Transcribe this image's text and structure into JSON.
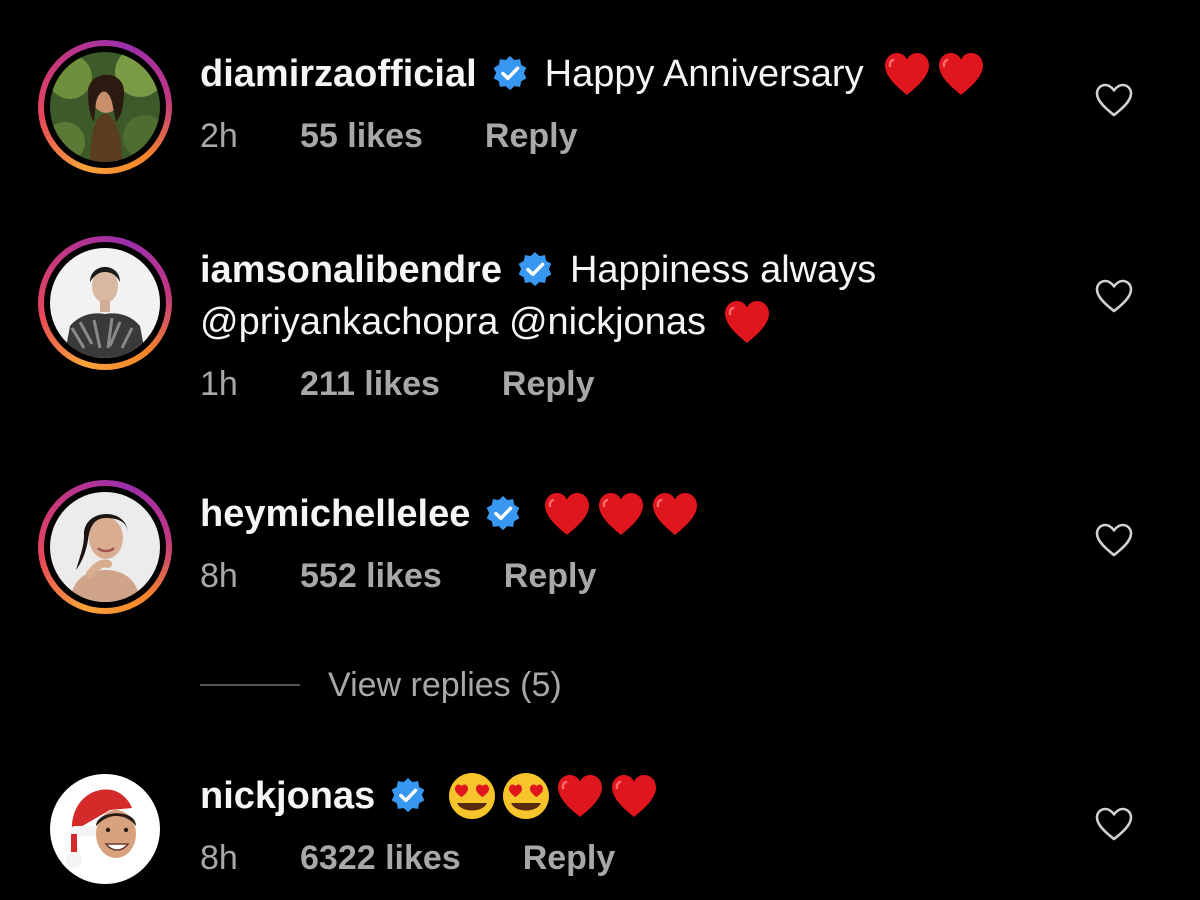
{
  "colors": {
    "background": "#000000",
    "text_primary": "#f5f5f5",
    "text_secondary": "#a8a8a8",
    "verified_blue": "#3897f0",
    "heart_red": "#e0161e"
  },
  "comments": [
    {
      "username": "diamirzaofficial",
      "verified": true,
      "text": "Happy Anniversary",
      "emojis": [
        "red-heart",
        "red-heart"
      ],
      "time": "2h",
      "likes": "55 likes",
      "reply_label": "Reply",
      "has_story_ring": true
    },
    {
      "username": "iamsonalibendre",
      "verified": true,
      "text": "Happiness always",
      "text_line2": "@priyankachopra @nickjonas",
      "emojis": [
        "red-heart"
      ],
      "time": "1h",
      "likes": "211 likes",
      "reply_label": "Reply",
      "has_story_ring": true
    },
    {
      "username": "heymichellelee",
      "verified": true,
      "text": "",
      "emojis": [
        "red-heart",
        "red-heart",
        "red-heart"
      ],
      "time": "8h",
      "likes": "552 likes",
      "reply_label": "Reply",
      "has_story_ring": true
    },
    {
      "username": "nickjonas",
      "verified": true,
      "text": "",
      "emojis": [
        "heart-eyes-smiley",
        "heart-eyes-smiley",
        "red-heart",
        "red-heart"
      ],
      "time": "8h",
      "likes": "6322 likes",
      "reply_label": "Reply",
      "has_story_ring": false
    }
  ],
  "view_replies": {
    "label": "View replies (5)"
  },
  "icons": {
    "verified": "verified-badge-icon",
    "like": "heart-outline-icon"
  }
}
